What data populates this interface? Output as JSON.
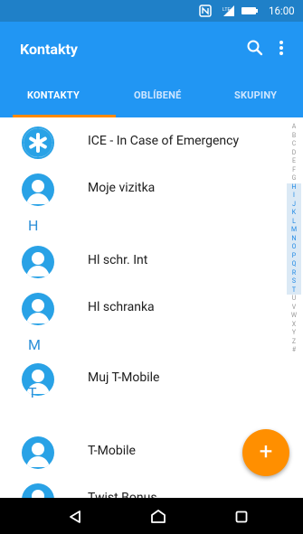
{
  "status_bar": {
    "time": "16:00",
    "nfc_icon": "nfc-icon",
    "signal_icon": "signal-icon",
    "battery_icon": "battery-icon"
  },
  "app_bar": {
    "title": "Kontakty",
    "search_icon": "search-icon",
    "overflow_icon": "more-vert-icon"
  },
  "tabs": [
    {
      "label": "KONTAKTY",
      "selected": true
    },
    {
      "label": "OBLÍBENÉ",
      "selected": false
    },
    {
      "label": "SKUPINY",
      "selected": false
    }
  ],
  "contacts": {
    "ice": "ICE - In Case of Emergency",
    "moje": "Moje vizitka",
    "section_h": "H",
    "hl_int": "Hl schr. Int",
    "hl_schranka": "Hl schranka",
    "section_m": "M",
    "muj": "Muj T-Mobile",
    "section_t": "T",
    "tmobile": "T-Mobile",
    "partial": "Twist Bonus"
  },
  "index_letters": [
    "A",
    "B",
    "C",
    "D",
    "E",
    "F",
    "G",
    "H",
    "I",
    "J",
    "K",
    "L",
    "M",
    "N",
    "O",
    "P",
    "Q",
    "R",
    "S",
    "T",
    "U",
    "V",
    "W",
    "X",
    "Y",
    "Z",
    "#"
  ],
  "index_highlighted": [
    "H",
    "I",
    "J",
    "K",
    "L",
    "M",
    "N",
    "O",
    "P",
    "Q",
    "R",
    "S",
    "T"
  ],
  "fab": {
    "label": "+",
    "icon": "add-icon"
  },
  "nav_bar": {
    "back_icon": "back-icon",
    "home_icon": "home-icon",
    "recents_icon": "recents-icon"
  },
  "colors": {
    "status_bar": "#1f80c8",
    "app_bar": "#2196f3",
    "accent": "#ff8f00",
    "section_letter": "#2c8fd8"
  }
}
